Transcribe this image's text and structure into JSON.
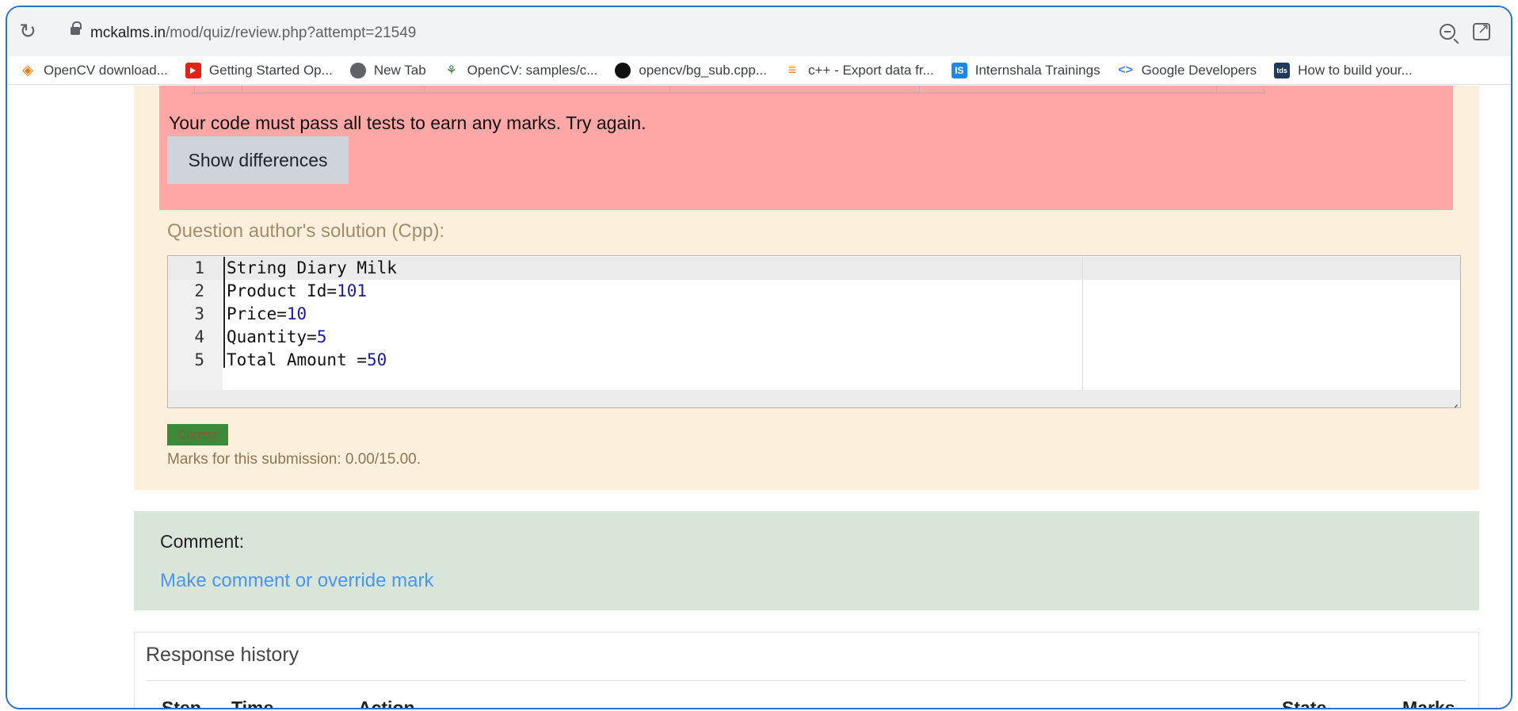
{
  "browser": {
    "url_host": "mckalms.in",
    "url_path": "/mod/quiz/review.php?attempt=21549",
    "bookmarks": [
      {
        "label": "OpenCV download...",
        "icon": "opencv-icon"
      },
      {
        "label": "Getting Started Op...",
        "icon": "youtube-icon"
      },
      {
        "label": "New Tab",
        "icon": "globe-icon"
      },
      {
        "label": "OpenCV: samples/c...",
        "icon": "opencv-samples-icon"
      },
      {
        "label": "opencv/bg_sub.cpp...",
        "icon": "github-icon"
      },
      {
        "label": "c++ - Export data fr...",
        "icon": "stackoverflow-icon"
      },
      {
        "label": "Internshala Trainings",
        "icon": "internshala-icon"
      },
      {
        "label": "Google Developers",
        "icon": "google-developers-icon"
      },
      {
        "label": "How to build your...",
        "icon": "tds-icon"
      }
    ]
  },
  "question": {
    "fail_message": "Your code must pass all tests to earn any marks. Try again.",
    "show_differences_label": "Show differences",
    "solution_label": "Question author's solution (Cpp):",
    "code_lines": [
      {
        "no": "1",
        "text": "String Diary Milk",
        "num": ""
      },
      {
        "no": "2",
        "text": "Product Id=",
        "num": "101"
      },
      {
        "no": "3",
        "text": "Price=",
        "num": "10"
      },
      {
        "no": "4",
        "text": "Quantity=",
        "num": "5"
      },
      {
        "no": "5",
        "text": "Total Amount =",
        "num": "50"
      }
    ],
    "badge_label": "Correct",
    "marks_text": "Marks for this submission: 0.00/15.00."
  },
  "comment": {
    "label": "Comment:",
    "link_text": "Make comment or override mark"
  },
  "history": {
    "title": "Response history",
    "columns": [
      "Step",
      "Time",
      "Action",
      "State",
      "Marks"
    ]
  },
  "colors": {
    "fail_panel": "#ffa6a6",
    "question_bg": "#fcefdc",
    "comment_bg": "#d8e5d8",
    "link": "#4a95f2",
    "correct_badge": "#3a8a3a"
  }
}
